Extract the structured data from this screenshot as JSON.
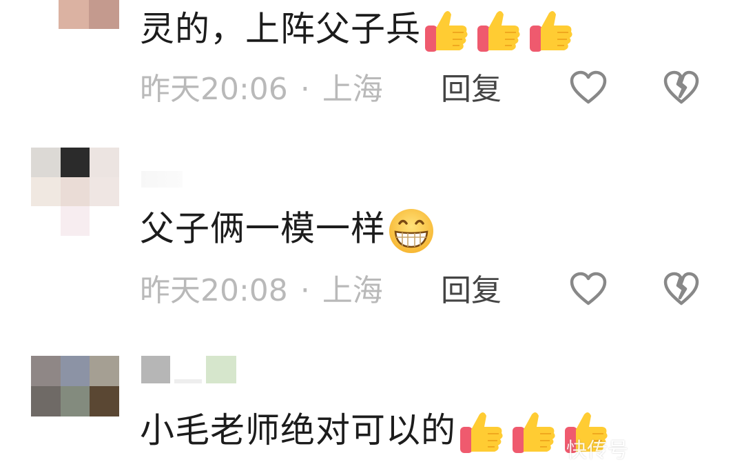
{
  "comments": [
    {
      "text": "灵的，上阵父子兵",
      "emoji": "thumbs-up x3",
      "time": "昨天20:06",
      "location": "上海",
      "separator": "·",
      "reply_label": "回复"
    },
    {
      "text": "父子俩一模一样",
      "emoji": "grinning-face",
      "time": "昨天20:08",
      "location": "上海",
      "separator": "·",
      "reply_label": "回复"
    },
    {
      "text": "小毛老师绝对可以的",
      "emoji": "thumbs-up x3"
    }
  ],
  "watermark": "快传号",
  "colors": {
    "text": "#1c1c1c",
    "meta": "#b9b9b9",
    "reply": "#444444",
    "icon_stroke": "#888888",
    "thumb_yellow": "#ffcc33",
    "thumb_cuff": "#ef5a6e"
  },
  "icons": {
    "like": "heart-outline-icon",
    "dislike": "broken-heart-icon"
  }
}
